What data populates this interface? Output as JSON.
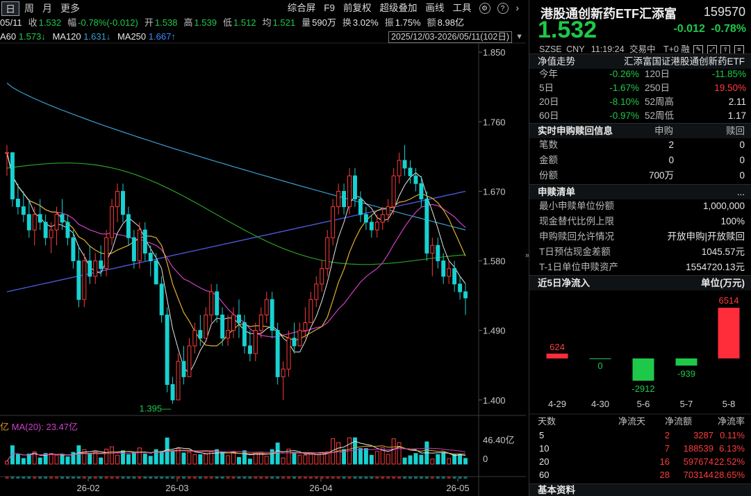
{
  "toolbar": {
    "periods": [
      "日",
      "周",
      "月",
      "更多"
    ],
    "tools": [
      "综合屏",
      "F9",
      "前复权",
      "超级叠加",
      "画线",
      "工具"
    ],
    "settings_glyph": "⚙",
    "help_glyph": "?",
    "next_glyph": "›"
  },
  "quote": {
    "date": "05/11",
    "close_label": "收",
    "close": "1.532",
    "amp_label": "幅",
    "amp": "-0.78%(-0.012)",
    "open_label": "开",
    "open": "1.538",
    "high_label": "高",
    "high": "1.539",
    "low_label": "低",
    "low": "1.512",
    "avg_label": "均",
    "avg": "1.521",
    "vol_label": "量",
    "vol": "590万",
    "turnover_label": "换",
    "turnover": "3.02%",
    "swing_label": "振",
    "swing": "1.75%",
    "amount_label": "额",
    "amount": "8.98亿"
  },
  "ma": {
    "ma60_label": "A60",
    "ma60": "1.573↓",
    "ma120_label": "MA120",
    "ma120": "1.631↓",
    "ma250_label": "MA250",
    "ma250": "1.667↑"
  },
  "range": {
    "text": "2025/12/03-2026/05/11(102日)",
    "arrow": "▼"
  },
  "colors": {
    "up": "#ff3b3b",
    "down": "#1ec94a",
    "candle_down": "#19d1d1",
    "ma5": "#e8e8e8",
    "ma10": "#e0b030",
    "ma20": "#d040c8",
    "ma60": "#28a028",
    "ma120": "#3aa0d0",
    "ma250": "#4a5ad8"
  },
  "chart_data": {
    "type": "candlestick",
    "y_ticks": [
      "1.850",
      "1.760",
      "1.670",
      "1.580",
      "1.490",
      "1.400"
    ],
    "ylim": [
      1.38,
      1.86
    ],
    "x_ticks": [
      "26-02",
      "26-03",
      "26-04",
      "26-05"
    ],
    "low_annotation": "1.395",
    "candles": [
      [
        1.72,
        1.73,
        1.69,
        1.72
      ],
      [
        1.72,
        1.72,
        1.65,
        1.66
      ],
      [
        1.66,
        1.68,
        1.64,
        1.65
      ],
      [
        1.65,
        1.67,
        1.63,
        1.64
      ],
      [
        1.64,
        1.66,
        1.61,
        1.62
      ],
      [
        1.62,
        1.65,
        1.6,
        1.64
      ],
      [
        1.64,
        1.66,
        1.62,
        1.63
      ],
      [
        1.63,
        1.64,
        1.6,
        1.61
      ],
      [
        1.61,
        1.63,
        1.59,
        1.62
      ],
      [
        1.62,
        1.65,
        1.6,
        1.64
      ],
      [
        1.64,
        1.66,
        1.62,
        1.63
      ],
      [
        1.63,
        1.64,
        1.6,
        1.61
      ],
      [
        1.61,
        1.62,
        1.57,
        1.58
      ],
      [
        1.58,
        1.6,
        1.52,
        1.53
      ],
      [
        1.53,
        1.59,
        1.52,
        1.58
      ],
      [
        1.58,
        1.6,
        1.55,
        1.56
      ],
      [
        1.56,
        1.59,
        1.55,
        1.58
      ],
      [
        1.58,
        1.6,
        1.56,
        1.57
      ],
      [
        1.57,
        1.62,
        1.56,
        1.61
      ],
      [
        1.61,
        1.66,
        1.6,
        1.65
      ],
      [
        1.65,
        1.68,
        1.63,
        1.67
      ],
      [
        1.67,
        1.68,
        1.63,
        1.64
      ],
      [
        1.64,
        1.65,
        1.6,
        1.61
      ],
      [
        1.61,
        1.62,
        1.57,
        1.58
      ],
      [
        1.58,
        1.63,
        1.57,
        1.62
      ],
      [
        1.62,
        1.63,
        1.58,
        1.59
      ],
      [
        1.59,
        1.6,
        1.56,
        1.58
      ],
      [
        1.58,
        1.59,
        1.55,
        1.55
      ],
      [
        1.55,
        1.56,
        1.5,
        1.51
      ],
      [
        1.51,
        1.52,
        1.41,
        1.42
      ],
      [
        1.42,
        1.43,
        1.395,
        1.4
      ],
      [
        1.4,
        1.46,
        1.4,
        1.45
      ],
      [
        1.45,
        1.47,
        1.42,
        1.43
      ],
      [
        1.43,
        1.48,
        1.43,
        1.47
      ],
      [
        1.47,
        1.5,
        1.46,
        1.49
      ],
      [
        1.49,
        1.51,
        1.47,
        1.48
      ],
      [
        1.48,
        1.52,
        1.48,
        1.51
      ],
      [
        1.51,
        1.55,
        1.5,
        1.54
      ],
      [
        1.54,
        1.55,
        1.5,
        1.51
      ],
      [
        1.51,
        1.52,
        1.47,
        1.48
      ],
      [
        1.48,
        1.51,
        1.47,
        1.49
      ],
      [
        1.49,
        1.52,
        1.48,
        1.51
      ],
      [
        1.51,
        1.53,
        1.48,
        1.5
      ],
      [
        1.5,
        1.51,
        1.46,
        1.47
      ],
      [
        1.47,
        1.49,
        1.45,
        1.46
      ],
      [
        1.46,
        1.5,
        1.45,
        1.49
      ],
      [
        1.49,
        1.52,
        1.48,
        1.51
      ],
      [
        1.51,
        1.54,
        1.5,
        1.53
      ],
      [
        1.53,
        1.54,
        1.48,
        1.49
      ],
      [
        1.49,
        1.5,
        1.42,
        1.43
      ],
      [
        1.43,
        1.45,
        1.4,
        1.44
      ],
      [
        1.44,
        1.49,
        1.43,
        1.48
      ],
      [
        1.48,
        1.5,
        1.46,
        1.47
      ],
      [
        1.47,
        1.5,
        1.47,
        1.49
      ],
      [
        1.49,
        1.52,
        1.48,
        1.5
      ],
      [
        1.5,
        1.54,
        1.5,
        1.53
      ],
      [
        1.53,
        1.56,
        1.52,
        1.55
      ],
      [
        1.55,
        1.58,
        1.54,
        1.57
      ],
      [
        1.57,
        1.62,
        1.56,
        1.61
      ],
      [
        1.61,
        1.66,
        1.6,
        1.65
      ],
      [
        1.65,
        1.68,
        1.64,
        1.67
      ],
      [
        1.67,
        1.68,
        1.64,
        1.65
      ],
      [
        1.65,
        1.7,
        1.64,
        1.69
      ],
      [
        1.69,
        1.7,
        1.65,
        1.66
      ],
      [
        1.66,
        1.67,
        1.63,
        1.64
      ],
      [
        1.64,
        1.65,
        1.62,
        1.63
      ],
      [
        1.63,
        1.64,
        1.61,
        1.62
      ],
      [
        1.62,
        1.64,
        1.61,
        1.63
      ],
      [
        1.63,
        1.65,
        1.62,
        1.64
      ],
      [
        1.64,
        1.66,
        1.63,
        1.65
      ],
      [
        1.65,
        1.7,
        1.64,
        1.69
      ],
      [
        1.69,
        1.72,
        1.68,
        1.71
      ],
      [
        1.71,
        1.73,
        1.69,
        1.7
      ],
      [
        1.7,
        1.71,
        1.68,
        1.69
      ],
      [
        1.69,
        1.7,
        1.67,
        1.68
      ],
      [
        1.68,
        1.69,
        1.65,
        1.66
      ],
      [
        1.66,
        1.67,
        1.58,
        1.59
      ],
      [
        1.59,
        1.61,
        1.56,
        1.6
      ],
      [
        1.6,
        1.61,
        1.57,
        1.58
      ],
      [
        1.58,
        1.59,
        1.55,
        1.56
      ],
      [
        1.56,
        1.58,
        1.55,
        1.57
      ],
      [
        1.57,
        1.58,
        1.54,
        1.55
      ],
      [
        1.55,
        1.56,
        1.53,
        1.54
      ],
      [
        1.54,
        1.55,
        1.51,
        1.532
      ]
    ]
  },
  "volume": {
    "label_prefix": "亿",
    "ma_label": "MA(20): 23.47亿",
    "max_tick": "46.40亿",
    "zero_tick": "0"
  },
  "stock": {
    "name": "港股通创新药ETF汇添富",
    "code": "159570",
    "price": "1.532",
    "change": "-0.012",
    "change_pct": "-0.78%",
    "exchange": "SZSE",
    "currency": "CNY",
    "time": "11:19:24",
    "status": "交易中",
    "settlement": "T+0",
    "margin": "融"
  },
  "nav": {
    "title": "净值走势",
    "fund_name": "汇添富国证港股通创新药ETF",
    "rows": [
      {
        "l1": "今年",
        "v1": "-0.26%",
        "l2": "120日",
        "v2": "-11.85%"
      },
      {
        "l1": "5日",
        "v1": "-1.67%",
        "l2": "250日",
        "v2": "19.50%"
      },
      {
        "l1": "20日",
        "v1": "-8.10%",
        "l2": "52周高",
        "v2": "2.11"
      },
      {
        "l1": "60日",
        "v1": "-0.97%",
        "l2": "52周低",
        "v2": "1.17"
      }
    ]
  },
  "realtime": {
    "title": "实时申购赎回信息",
    "col1": "申购",
    "col2": "赎回",
    "rows": [
      {
        "label": "笔数",
        "a": "2",
        "b": "0"
      },
      {
        "label": "金额",
        "a": "0",
        "b": "0"
      },
      {
        "label": "份额",
        "a": "700万",
        "b": "0"
      }
    ]
  },
  "redeem_list": {
    "title": "申赎清单",
    "more": "...",
    "rows": [
      {
        "label": "最小申赎单位份额",
        "value": "1,000,000"
      },
      {
        "label": "现金替代比例上限",
        "value": "100%"
      },
      {
        "label": "申购赎回允许情况",
        "value": "开放申购|开放赎回"
      },
      {
        "label": "T日预估现金差额",
        "value": "1045.57元"
      },
      {
        "label": "T-1日单位申赎资产",
        "value": "1554720.13元"
      }
    ]
  },
  "netflow": {
    "title": "近5日净流入",
    "unit": "单位(万元)",
    "chart_data": {
      "type": "bar",
      "categories": [
        "4-29",
        "4-30",
        "5-6",
        "5-7",
        "5-8"
      ],
      "values": [
        624,
        0,
        -2912,
        -939,
        6514
      ],
      "labels": [
        "624",
        "0",
        "-2912",
        "-939",
        "6514"
      ]
    }
  },
  "flow_table": {
    "headers": [
      "天数",
      "净流天",
      "净流额",
      "净流率"
    ],
    "rows": [
      {
        "days": "5",
        "n": "2",
        "amt": "3287",
        "rate": "0.11%"
      },
      {
        "days": "10",
        "n": "7",
        "amt": "188539",
        "rate": "6.13%"
      },
      {
        "days": "20",
        "n": "16",
        "amt": "597674",
        "rate": "22.52%"
      },
      {
        "days": "60",
        "n": "28",
        "amt": "703144",
        "rate": "28.65%"
      }
    ]
  },
  "basic": {
    "title": "基本资料"
  }
}
